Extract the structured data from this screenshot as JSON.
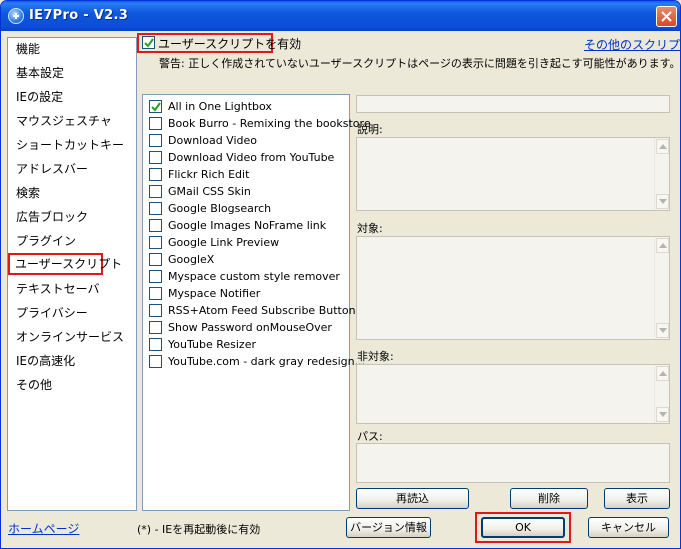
{
  "window": {
    "title": "IE7Pro - V2.3"
  },
  "sidebar": {
    "items": [
      {
        "label": "機能"
      },
      {
        "label": "基本設定"
      },
      {
        "label": "IEの設定"
      },
      {
        "label": "マウスジェスチャ"
      },
      {
        "label": "ショートカットキー"
      },
      {
        "label": "アドレスバー"
      },
      {
        "label": "検索"
      },
      {
        "label": "広告ブロック"
      },
      {
        "label": "プラグイン"
      },
      {
        "label": "ユーザースクリプト",
        "selected": true
      },
      {
        "label": "テキストセーバ"
      },
      {
        "label": "プライバシー"
      },
      {
        "label": "オンラインサービス"
      },
      {
        "label": "IEの高速化"
      },
      {
        "label": "その他"
      }
    ]
  },
  "userscript": {
    "enable_label": "ユーザースクリプトを有効",
    "enabled": true,
    "other_scripts_link": "その他のスクリプト",
    "warning": "警告: 正しく作成されていないユーザースクリプトはページの表示に問題を引き起こす可能性があります。"
  },
  "scripts": [
    {
      "name": "All in One Lightbox",
      "checked": true
    },
    {
      "name": "Book Burro - Remixing the bookstore",
      "checked": false
    },
    {
      "name": "Download Video",
      "checked": false
    },
    {
      "name": "Download Video from YouTube",
      "checked": false
    },
    {
      "name": "Flickr Rich Edit",
      "checked": false
    },
    {
      "name": "GMail CSS Skin",
      "checked": false
    },
    {
      "name": "Google Blogsearch",
      "checked": false
    },
    {
      "name": "Google Images NoFrame link",
      "checked": false
    },
    {
      "name": "Google Link Preview",
      "checked": false
    },
    {
      "name": "GoogleX",
      "checked": false
    },
    {
      "name": "Myspace custom style remover",
      "checked": false
    },
    {
      "name": "Myspace Notifier",
      "checked": false
    },
    {
      "name": "RSS+Atom Feed Subscribe Button ...",
      "checked": false
    },
    {
      "name": "Show Password onMouseOver",
      "checked": false
    },
    {
      "name": "YouTube Resizer",
      "checked": false
    },
    {
      "name": "YouTube.com - dark gray redesign...",
      "checked": false
    }
  ],
  "details": {
    "name_value": "",
    "description_label": "説明:",
    "description_value": "",
    "target_label": "対象:",
    "target_value": "",
    "exclude_label": "非対象:",
    "exclude_value": "",
    "path_label": "パス:",
    "path_value": ""
  },
  "actions": {
    "reload": "再読込",
    "delete": "削除",
    "show": "表示"
  },
  "footer": {
    "homepage_link": "ホームページ",
    "restart_note": "(*) - IEを再起動後に有効",
    "version_info": "バージョン情報",
    "ok": "OK",
    "cancel": "キャンセル"
  },
  "colors": {
    "titlebar": "#0b4fd6",
    "highlight": "#e01818",
    "link": "#0033cc"
  }
}
